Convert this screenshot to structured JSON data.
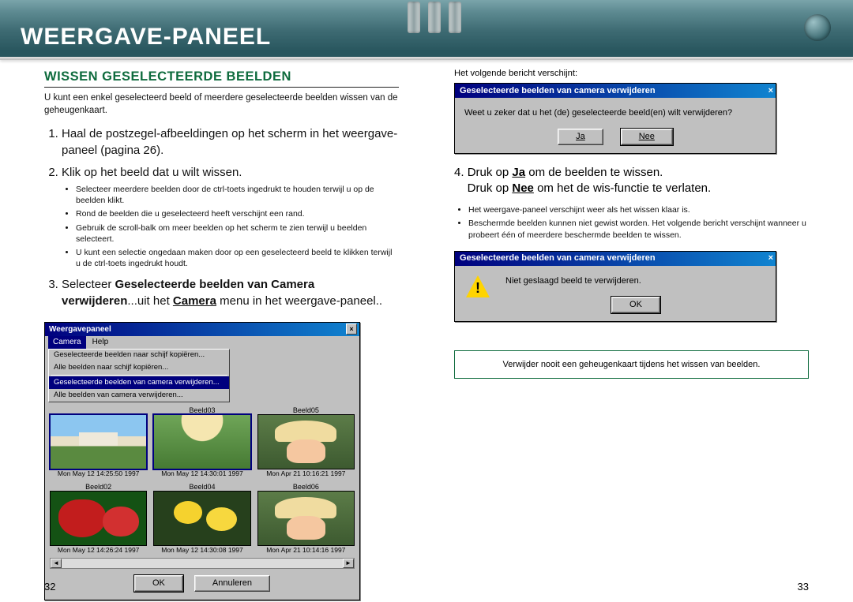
{
  "header": {
    "title": "WEERGAVE-PANEEL"
  },
  "left": {
    "section_title": "WISSEN GESELECTEERDE BEELDEN",
    "intro": "U kunt een enkel geselecteerd beeld of meerdere geselecteerde beelden wissen van de geheugenkaart.",
    "step1": "Haal de postzegel-afbeeldingen op het scherm in het weergave-paneel (pagina 26).",
    "step2": "Klik op het beeld dat u wilt wissen.",
    "sub2": [
      "Selecteer meerdere beelden door de ctrl-toets ingedrukt te houden terwijl u op de beelden klikt.",
      "Rond de beelden die u geselecteerd heeft verschijnt een rand.",
      "Gebruik de scroll-balk om meer beelden op het scherm te zien terwijl u beelden selecteert.",
      "U kunt een selectie ongedaan maken door op een geselecteerd beeld te klikken terwijl u de ctrl-toets ingedrukt houdt."
    ],
    "step3_a": "Selecteer ",
    "step3_b": "Geselecteerde beelden van Camera verwijderen",
    "step3_c": "...uit het ",
    "step3_d": "Camera",
    "step3_e": " menu in het weergave-paneel..",
    "fig_title": "Weergavepaneel",
    "menu_camera": "Camera",
    "menu_help": "Help",
    "dd_items": [
      "Geselecteerde beelden naar schijf kopiëren...",
      "Alle beelden naar schijf kopiëren..."
    ],
    "dd_highlight": "Geselecteerde beelden van camera verwijderen...",
    "dd_after": "Alle beelden van camera verwijderen...",
    "thumbs": [
      {
        "top": "",
        "bot": "Mon May 12 14:25:50 1997",
        "cls": "castle",
        "sel": true
      },
      {
        "top": "Beeld03",
        "bot": "Mon May 12 14:30:01 1997",
        "cls": "hat",
        "sel": true
      },
      {
        "top": "Beeld05",
        "bot": "Mon Apr 21 10:16:21 1997",
        "cls": "straw",
        "sel": false
      },
      {
        "top": "Beeld02",
        "bot": "Mon May 12 14:26:24 1997",
        "cls": "strawberry",
        "sel": false
      },
      {
        "top": "Beeld04",
        "bot": "Mon May 12 14:30:08 1997",
        "cls": "dandelion",
        "sel": false
      },
      {
        "top": "Beeld06",
        "bot": "Mon Apr 21 10:14:16 1997",
        "cls": "straw",
        "sel": false
      }
    ],
    "btn_ok": "OK",
    "btn_cancel": "Annuleren"
  },
  "right": {
    "notice": "Het volgende bericht verschijnt:",
    "dlg1_title": "Geselecteerde beelden van camera verwijderen",
    "dlg1_msg": "Weet u zeker dat u het (de) geselecteerde beeld(en) wilt verwijderen?",
    "btn_yes": "Ja",
    "btn_no": "Nee",
    "step4_a": "Druk op ",
    "step4_b": "Ja",
    "step4_c": " om de beelden te wissen.",
    "step4_d": "Druk op ",
    "step4_e": "Nee",
    "step4_f": " om het de wis-functie te verlaten.",
    "sub4": [
      "Het weergave-paneel verschijnt weer als het wissen klaar is.",
      "Beschermde beelden kunnen niet gewist worden. Het volgende bericht verschijnt wanneer u probeert één of meerdere beschermde beelden te wissen."
    ],
    "dlg2_title": "Geselecteerde beelden van camera verwijderen",
    "dlg2_msg": "Niet geslaagd beeld te verwijderen.",
    "btn_ok": "OK",
    "warning": "Verwijder nooit een geheugenkaart tijdens het wissen van beelden."
  },
  "page_left": "32",
  "page_right": "33"
}
